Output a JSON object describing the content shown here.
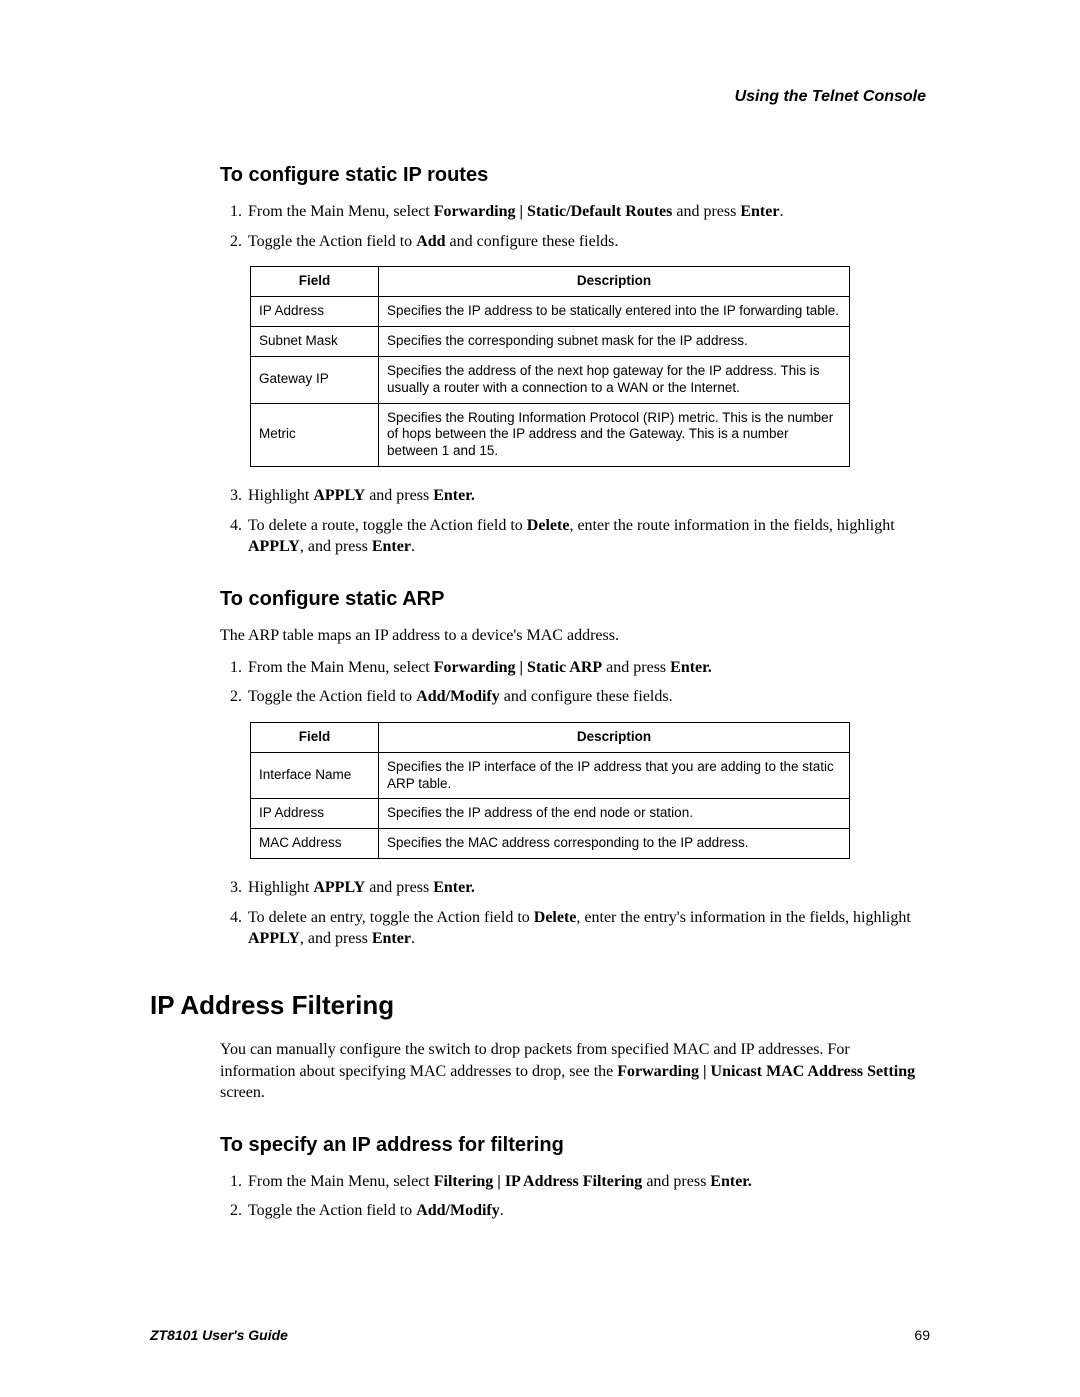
{
  "header": {
    "title": "Using the Telnet Console"
  },
  "section1": {
    "heading": "To configure static IP routes",
    "steps": {
      "s1_pre": "From the Main Menu, select ",
      "s1_b1": "Forwarding | Static/Default Routes",
      "s1_mid": " and press ",
      "s1_b2": "Enter",
      "s1_post": ".",
      "s2_pre": "Toggle the Action field to ",
      "s2_b1": "Add",
      "s2_post": " and configure these fields.",
      "s3_pre": "Highlight ",
      "s3_b1": "APPLY",
      "s3_mid": " and press ",
      "s3_b2": "Enter.",
      "s4_pre": "To delete a route, toggle the Action field to ",
      "s4_b1": "Delete",
      "s4_mid1": ", enter the route information in the fields, highlight ",
      "s4_b2": "APPLY",
      "s4_mid2": ", and press ",
      "s4_b3": "Enter",
      "s4_post": "."
    },
    "table": {
      "headers": {
        "field": "Field",
        "desc": "Description"
      },
      "rows": [
        {
          "field": "IP Address",
          "desc": "Specifies the IP address to be statically entered into the IP forwarding table."
        },
        {
          "field": "Subnet Mask",
          "desc": "Specifies the corresponding subnet mask for the IP address."
        },
        {
          "field": "Gateway IP",
          "desc": "Specifies the address of the next hop gateway for the IP address. This is usually a router with a connection to a WAN or the Internet."
        },
        {
          "field": "Metric",
          "desc": "Specifies the Routing Information Protocol (RIP) metric. This is the number of hops between the IP address and the Gateway. This is a number between 1 and 15."
        }
      ]
    }
  },
  "section2": {
    "heading": "To configure static ARP",
    "intro": "The ARP table maps an IP address to a device's MAC address.",
    "steps": {
      "s1_pre": "From the Main Menu, select ",
      "s1_b1": "Forwarding | Static ARP",
      "s1_mid": " and press ",
      "s1_b2": "Enter.",
      "s2_pre": "Toggle the Action field to ",
      "s2_b1": "Add/Modify",
      "s2_post": " and configure these fields.",
      "s3_pre": "Highlight ",
      "s3_b1": "APPLY",
      "s3_mid": " and press ",
      "s3_b2": "Enter.",
      "s4_pre": "To delete an entry, toggle the Action field to ",
      "s4_b1": "Delete",
      "s4_mid1": ", enter the entry's information in the fields, highlight ",
      "s4_b2": "APPLY",
      "s4_mid2": ", and press ",
      "s4_b3": "Enter",
      "s4_post": "."
    },
    "table": {
      "headers": {
        "field": "Field",
        "desc": "Description"
      },
      "rows": [
        {
          "field": "Interface Name",
          "desc": "Specifies the IP interface of the IP address that you are adding to the static ARP table."
        },
        {
          "field": "IP Address",
          "desc": "Specifies the IP address of the end node or station."
        },
        {
          "field": "MAC Address",
          "desc": "Specifies the MAC address corresponding to the IP address."
        }
      ]
    }
  },
  "section3": {
    "heading": "IP Address Filtering",
    "intro_pre": "You can manually configure the switch to drop packets from specified MAC and IP addresses. For information about specifying MAC addresses to drop, see the ",
    "intro_b1": "Forwarding | Unicast MAC Address Setting",
    "intro_post": " screen.",
    "sub": {
      "heading": "To specify an IP address for filtering",
      "steps": {
        "s1_pre": "From the Main Menu, select ",
        "s1_b1": "Filtering | IP Address Filtering",
        "s1_mid": " and press ",
        "s1_b2": "Enter.",
        "s2_pre": "Toggle the Action field to ",
        "s2_b1": "Add/Modify",
        "s2_post": "."
      }
    }
  },
  "footer": {
    "guide": "ZT8101 User's Guide",
    "page": "69"
  }
}
